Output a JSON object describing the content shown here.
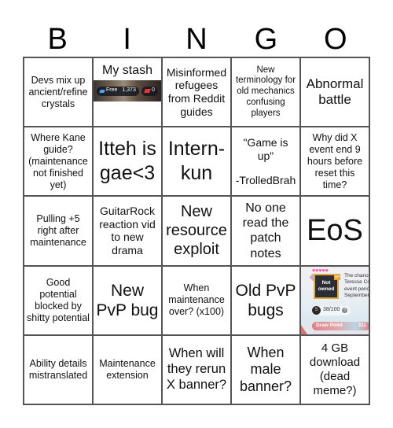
{
  "header": {
    "letters": [
      "B",
      "I",
      "N",
      "G",
      "O"
    ]
  },
  "cells": {
    "r1c1": "Devs mix up ancient/refine crystals",
    "r1c2": {
      "title": "My stash",
      "image": {
        "free_label": "Free",
        "free_count": "1,373",
        "paid_count": "0"
      }
    },
    "r1c3": "Misinformed refugees from Reddit guides",
    "r1c4": "New terminology for old mechanics confusing players",
    "r1c5": "Abnormal battle",
    "r2c1": "Where Kane guide? (maintenance not finished yet)",
    "r2c2": "Itteh is gae<3",
    "r2c3": "Intern-kun",
    "r2c4": {
      "quote": "\"Game is up\"",
      "author": "-TrolledBrah"
    },
    "r2c5": "Why did X event end 9 hours before reset this time?",
    "r3c1": "Pulling +5 right after maintenance",
    "r3c2": "GuitarRock reaction vid to new drama",
    "r3c3": "New resource exploit",
    "r3c4": "No one read the patch notes",
    "r3c5": "EoS",
    "r4c1": "Good potential blocked by shitty potential",
    "r4c2": "New PvP bug",
    "r4c3": "When maintenance over? (x100)",
    "r4c4": "Old PvP bugs",
    "r4c5": {
      "hearts": "♥♥♥♥♥",
      "status": "Not owned",
      "badge": "UP",
      "desc_lines": [
        "The chance",
        "Teresse Co",
        "event perio",
        "September"
      ],
      "coin_symbol": "S",
      "counter": "38/100",
      "help": "?",
      "draw_label": "Draw Point",
      "draw_value": "311"
    },
    "r5c1": "Ability details mistranslated",
    "r5c2": "Maintenance extension",
    "r5c3": "When will they rerun X banner?",
    "r5c4": "When male banner?",
    "r5c5": "4 GB download (dead meme?)"
  }
}
